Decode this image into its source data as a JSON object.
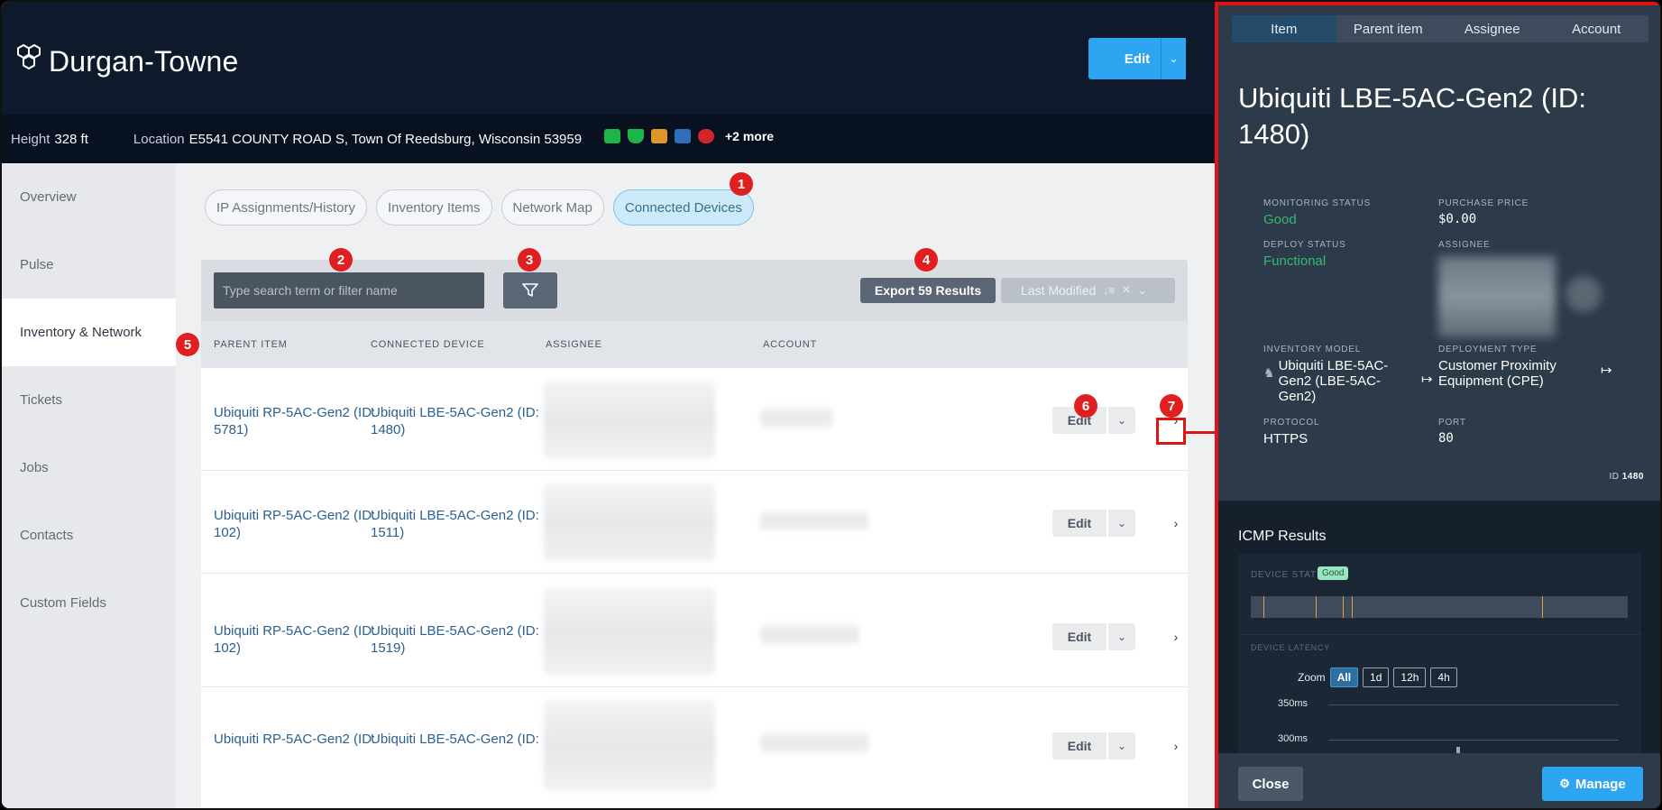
{
  "header": {
    "brand": "Durgan-Towne",
    "edit_label": "Edit"
  },
  "infobar": {
    "height_label": "Height",
    "height_value": "328 ft",
    "location_label": "Location",
    "location_value": "E5541 COUNTY ROAD S, Town Of Reedsburg, Wisconsin 53959",
    "more_label": "+2 more",
    "badge_colors": [
      "#1db44a",
      "#1db44a",
      "#e0952a",
      "#2f6fb8",
      "#d0262b"
    ]
  },
  "sidebar": {
    "items": [
      {
        "label": "Overview"
      },
      {
        "label": "Pulse"
      },
      {
        "label": "Inventory & Network"
      },
      {
        "label": "Tickets"
      },
      {
        "label": "Jobs"
      },
      {
        "label": "Contacts"
      },
      {
        "label": "Custom Fields"
      }
    ],
    "active": "Inventory & Network"
  },
  "tabs": [
    {
      "label": "IP Assignments/History"
    },
    {
      "label": "Inventory Items"
    },
    {
      "label": "Network Map"
    },
    {
      "label": "Connected Devices"
    }
  ],
  "toolbar": {
    "search_placeholder": "Type search term or filter name",
    "export_label": "Export 59 Results",
    "sort_label": "Last Modified"
  },
  "table": {
    "headers": [
      "PARENT ITEM",
      "CONNECTED DEVICE",
      "ASSIGNEE",
      "ACCOUNT"
    ],
    "rows": [
      {
        "parent": "Ubiquiti RP-5AC-Gen2 (ID: 5781)",
        "device": "Ubiquiti LBE-5AC-Gen2 (ID: 1480)",
        "edit": "Edit"
      },
      {
        "parent": "Ubiquiti RP-5AC-Gen2 (ID: 102)",
        "device": "Ubiquiti LBE-5AC-Gen2 (ID: 1511)",
        "edit": "Edit"
      },
      {
        "parent": "Ubiquiti RP-5AC-Gen2 (ID: 102)",
        "device": "Ubiquiti LBE-5AC-Gen2 (ID: 1519)",
        "edit": "Edit"
      },
      {
        "parent": "Ubiquiti RP-5AC-Gen2 (ID:",
        "device": "Ubiquiti LBE-5AC-Gen2 (ID:",
        "edit": "Edit"
      }
    ]
  },
  "markers": [
    "1",
    "2",
    "3",
    "4",
    "5",
    "6",
    "7"
  ],
  "panel": {
    "tabs": [
      "Item",
      "Parent item",
      "Assignee",
      "Account"
    ],
    "active_tab": "Item",
    "title": "Ubiquiti LBE-5AC-Gen2 (ID: 1480)",
    "fields": {
      "monitoring_status_label": "MONITORING STATUS",
      "monitoring_status_value": "Good",
      "purchase_price_label": "PURCHASE PRICE",
      "purchase_price_value": "$0.00",
      "deploy_status_label": "DEPLOY STATUS",
      "deploy_status_value": "Functional",
      "assignee_label": "ASSIGNEE",
      "inventory_model_label": "INVENTORY MODEL",
      "inventory_model_value": "Ubiquiti LBE-5AC-Gen2 (LBE-5AC-Gen2)",
      "deployment_type_label": "DEPLOYMENT TYPE",
      "deployment_type_value": "Customer Proximity Equipment (CPE)",
      "protocol_label": "PROTOCOL",
      "protocol_value": "HTTPS",
      "port_label": "PORT",
      "port_value": "80"
    },
    "id_label": "ID",
    "id_value": "1480",
    "icmp": {
      "title": "ICMP Results",
      "device_status_label": "DEVICE STATUS",
      "device_status_value": "Good",
      "device_latency_label": "DEVICE LATENCY",
      "zoom_label": "Zoom",
      "zoom_options": [
        "All",
        "1d",
        "12h",
        "4h"
      ],
      "zoom_active": "All",
      "y_ticks": [
        "350ms",
        "300ms"
      ]
    },
    "close_label": "Close",
    "manage_label": "Manage"
  },
  "colors": {
    "accent": "#2ea5f0",
    "header_bg": "#0e1a2b",
    "panel_bg": "#2d3a49",
    "highlight": "#e01414",
    "good": "#35b870"
  }
}
